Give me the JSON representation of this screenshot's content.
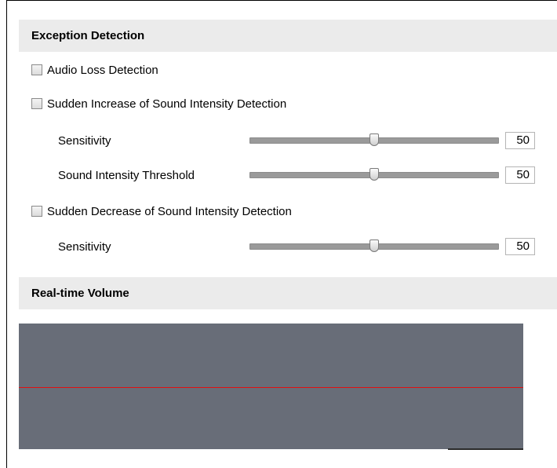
{
  "exception": {
    "header": "Exception Detection",
    "audio_loss_label": "Audio Loss Detection",
    "audio_loss_checked": false,
    "increase_label": "Sudden Increase of Sound Intensity Detection",
    "increase_checked": false,
    "increase_sensitivity_label": "Sensitivity",
    "increase_sensitivity_value": "50",
    "threshold_label": "Sound Intensity Threshold",
    "threshold_value": "50",
    "decrease_label": "Sudden Decrease of Sound Intensity Detection",
    "decrease_checked": false,
    "decrease_sensitivity_label": "Sensitivity",
    "decrease_sensitivity_value": "50"
  },
  "volume": {
    "header": "Real-time Volume",
    "panel_color": "#686d78",
    "threshold_line_color": "#e01010"
  }
}
